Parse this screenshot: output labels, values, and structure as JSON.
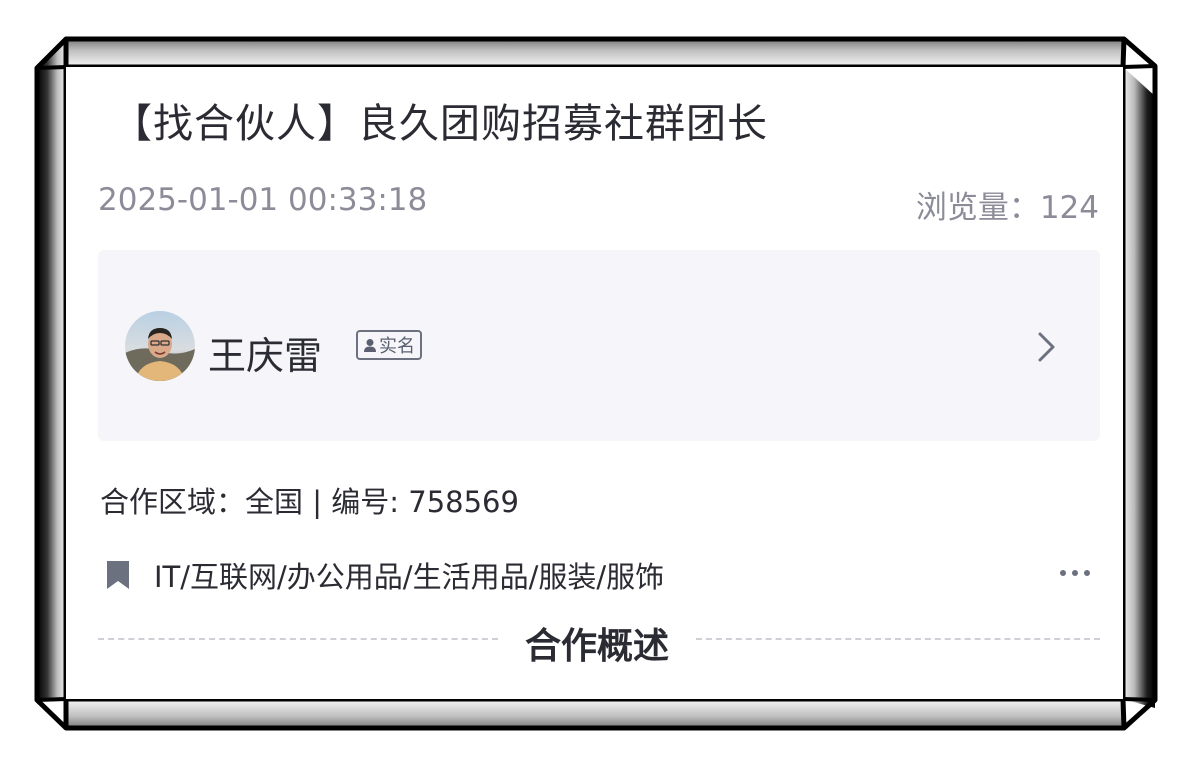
{
  "post": {
    "title": "【找合伙人】良久团购招募社群团长",
    "datetime": "2025-01-01 00:33:18",
    "views_label": "浏览量：",
    "views_count": "124"
  },
  "author": {
    "name": "王庆雷",
    "badge_label": "实名",
    "avatar_icon": "avatar-photo",
    "chevron_icon": "chevron-right-icon"
  },
  "details": {
    "region_label": "合作区域：",
    "region_value": "全国",
    "separator": " | ",
    "number_label": "编号: ",
    "number_value": "758569"
  },
  "tags": {
    "icon": "bookmark-icon",
    "text": "IT/互联网/办公用品/生活用品/服装/服饰",
    "more_icon": "more-dots-icon"
  },
  "section": {
    "title": "合作概述"
  },
  "colors": {
    "text_primary": "#2b2b33",
    "text_secondary": "#8c8c99",
    "author_box_bg": "#f6f6fa",
    "icon_gray": "#6c7180"
  }
}
